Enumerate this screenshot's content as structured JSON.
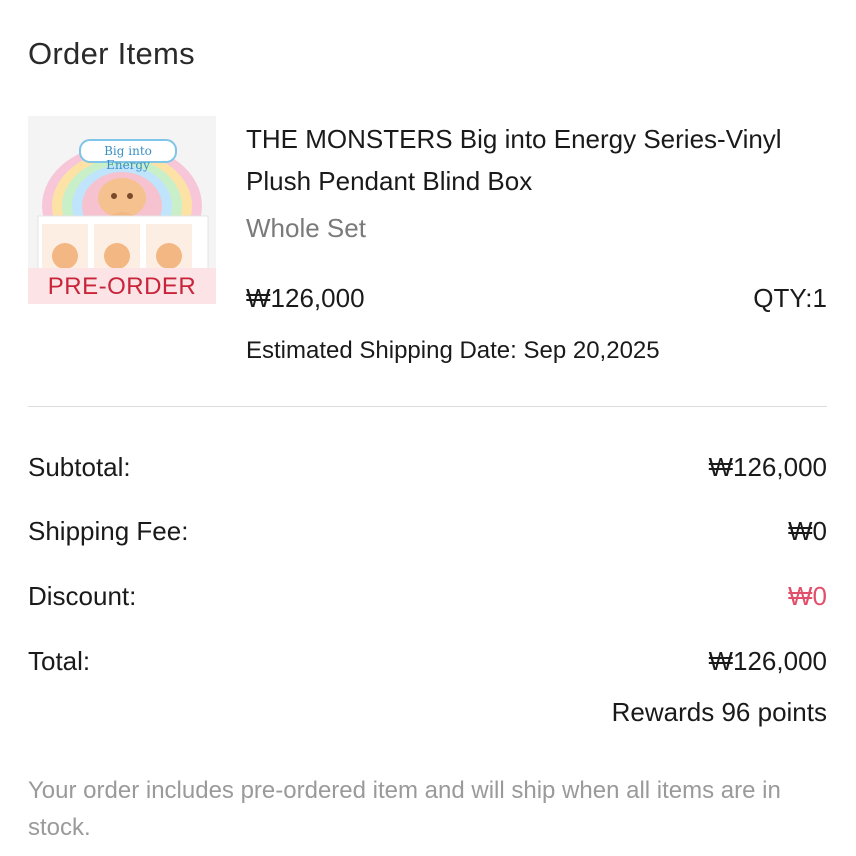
{
  "section": {
    "title": "Order Items"
  },
  "item": {
    "image_alt": "THE MONSTERS Big into Energy blind box product image",
    "image_logo_text": "Big into Energy",
    "badge": "PRE-ORDER",
    "name": "THE MONSTERS Big into Energy Series-Vinyl Plush Pendant Blind Box",
    "variant": "Whole Set",
    "price": "₩126,000",
    "qty": "QTY:1",
    "ship_date": "Estimated Shipping Date: Sep 20,2025"
  },
  "summary": {
    "subtotal_label": "Subtotal:",
    "subtotal_value": "₩126,000",
    "shipping_label": "Shipping Fee:",
    "shipping_value": "₩0",
    "discount_label": "Discount:",
    "discount_value": "₩0",
    "total_label": "Total:",
    "total_value": "₩126,000",
    "rewards": "Rewards 96 points"
  },
  "note": "Your order includes pre-ordered item and will ship when all items are in stock.",
  "colors": {
    "badge_bg": "#fbe3e6",
    "badge_text": "#c8253a",
    "discount": "#e0506a",
    "muted": "#9a9a9a"
  }
}
